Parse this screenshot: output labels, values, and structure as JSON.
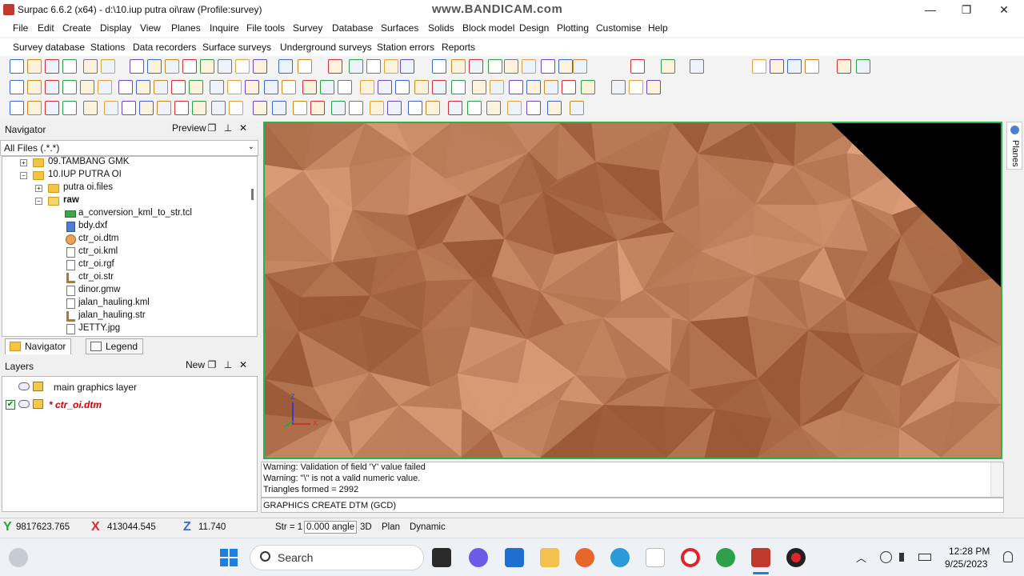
{
  "window": {
    "title": "Surpac 6.6.2 (x64) - d:\\10.iup putra oi\\raw (Profile:survey)",
    "watermark": "www.BANDICAM.com",
    "minimize": "—",
    "maximize": "❐",
    "close": "✕"
  },
  "menu": [
    "File",
    "Edit",
    "Create",
    "Display",
    "View",
    "Planes",
    "Inquire",
    "File tools",
    "Survey",
    "Database",
    "Surfaces",
    "Solids",
    "Block model",
    "Design",
    "Plotting",
    "Customise",
    "Help"
  ],
  "submenu": [
    "Survey database",
    "Stations",
    "Data recorders",
    "Surface surveys",
    "Underground surveys",
    "Station errors",
    "Reports"
  ],
  "navigator": {
    "title": "Navigator",
    "preview_label": "Preview",
    "float_icon": "❐",
    "pin_icon": "⊥",
    "close_icon": "✕",
    "filter": "All Files (.*.*)",
    "tree": [
      {
        "label": "09.TAMBANG GMK",
        "type": "folder",
        "expander": "+"
      },
      {
        "label": "10.IUP PUTRA OI",
        "type": "folder",
        "expander": "−"
      },
      {
        "label": "putra oi.files",
        "type": "folder",
        "expander": "+"
      },
      {
        "label": "raw",
        "type": "folder-open",
        "expander": "−"
      },
      {
        "label": "a_conversion_kml_to_str.tcl",
        "type": "file"
      },
      {
        "label": "bdy.dxf",
        "type": "file"
      },
      {
        "label": "ctr_oi.dtm",
        "type": "file"
      },
      {
        "label": "ctr_oi.kml",
        "type": "file"
      },
      {
        "label": "ctr_oi.rgf",
        "type": "file"
      },
      {
        "label": "ctr_oi.str",
        "type": "file"
      },
      {
        "label": "dinor.gmw",
        "type": "file"
      },
      {
        "label": "jalan_hauling.kml",
        "type": "file"
      },
      {
        "label": "jalan_hauling.str",
        "type": "file"
      },
      {
        "label": "JETTY.jpg",
        "type": "file"
      }
    ],
    "tabs": [
      "Navigator",
      "Legend"
    ]
  },
  "layers": {
    "title": "Layers",
    "new_label": "New",
    "float_icon": "❐",
    "pin_icon": "⊥",
    "close_icon": "✕",
    "items": [
      {
        "label": "main graphics layer",
        "active": false
      },
      {
        "label": "* ctr_oi.dtm",
        "active": true
      }
    ]
  },
  "planes_tab": "Planes",
  "console": {
    "lines": [
      "Warning: Validation of field 'Y' value failed",
      "Warning: \"\\\" is not a valid numeric value.",
      "Triangles formed = 2992"
    ],
    "command": "GRAPHICS CREATE DTM (GCD)"
  },
  "status": {
    "y_label": "Y",
    "y_value": "9817623.765",
    "x_label": "X",
    "x_value": "413044.545",
    "z_label": "Z",
    "z_value": "11.740",
    "str": "Str = 1",
    "angle": "0.000 angle",
    "mode_3d": "3D",
    "plan": "Plan",
    "dynamic": "Dynamic"
  },
  "taskbar": {
    "search_placeholder": "Search",
    "time": "12:28 PM",
    "date": "9/25/2023",
    "tray_arrow": "︿"
  },
  "axes": {
    "z": "Z",
    "x": "X"
  },
  "colors": {
    "terrain_base": "#c8835a",
    "terrain_dark": "#9a5a38",
    "terrain_light": "#e5a882",
    "viewport_border": "#2bb24c",
    "layer_active_text": "#cc0000"
  }
}
